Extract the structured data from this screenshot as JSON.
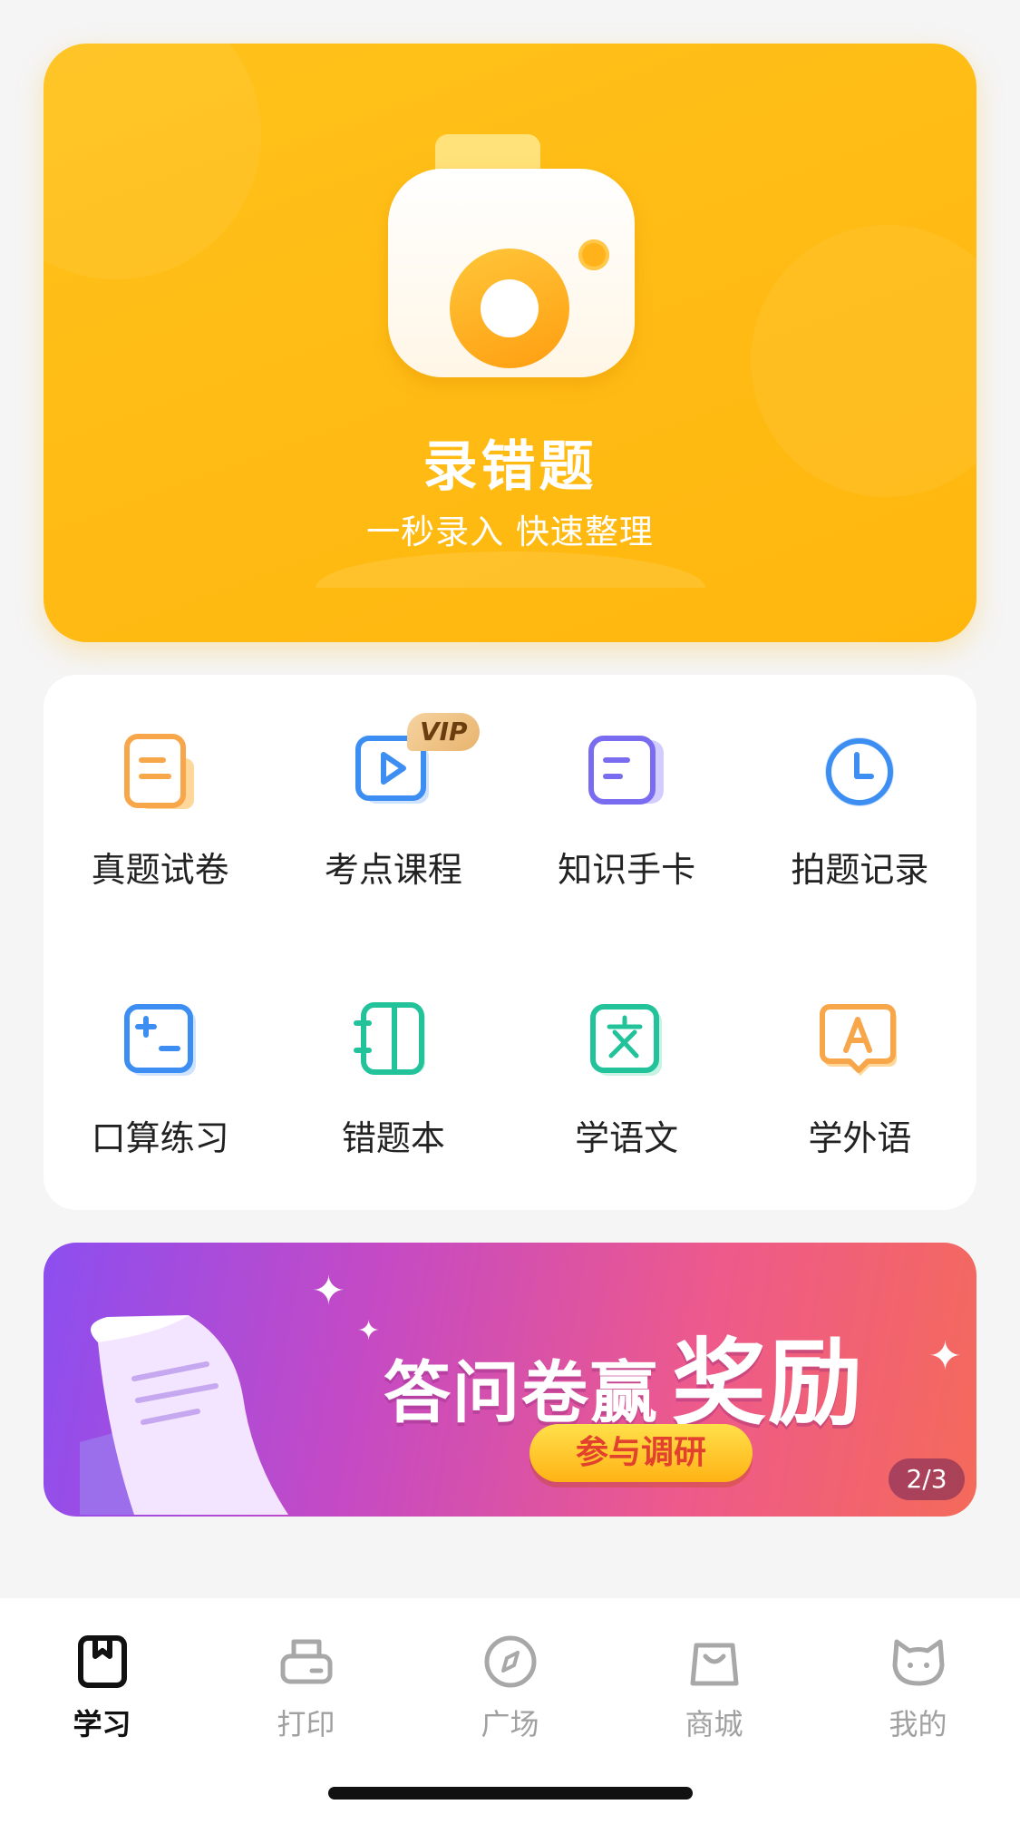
{
  "hero": {
    "title": "录错题",
    "subtitle": "一秒录入 快速整理",
    "bg_color": "#ffbb14"
  },
  "grid": {
    "items": [
      {
        "label": "真题试卷",
        "icon": "paper-doc-icon",
        "color": "#f7a64a"
      },
      {
        "label": "考点课程",
        "icon": "video-play-icon",
        "color": "#3d8ef2",
        "badge": "VIP"
      },
      {
        "label": "知识手卡",
        "icon": "cards-icon",
        "color": "#7a6cf0"
      },
      {
        "label": "拍题记录",
        "icon": "clock-icon",
        "color": "#3d8ef2"
      },
      {
        "label": "口算练习",
        "icon": "calculator-icon",
        "color": "#3d8ef2"
      },
      {
        "label": "错题本",
        "icon": "notebook-icon",
        "color": "#22c39a"
      },
      {
        "label": "学语文",
        "icon": "chinese-char-icon",
        "color": "#22c39a"
      },
      {
        "label": "学外语",
        "icon": "letter-a-icon",
        "color": "#f7a64a"
      }
    ]
  },
  "banner": {
    "title": "答问卷赢",
    "title_big": "奖励",
    "button": "参与调研",
    "page": "2/3"
  },
  "tabbar": {
    "items": [
      {
        "label": "学习",
        "icon": "book-icon",
        "active": true
      },
      {
        "label": "打印",
        "icon": "printer-icon",
        "active": false
      },
      {
        "label": "广场",
        "icon": "compass-icon",
        "active": false
      },
      {
        "label": "商城",
        "icon": "shopping-bag-icon",
        "active": false
      },
      {
        "label": "我的",
        "icon": "cat-face-icon",
        "active": false
      }
    ]
  }
}
